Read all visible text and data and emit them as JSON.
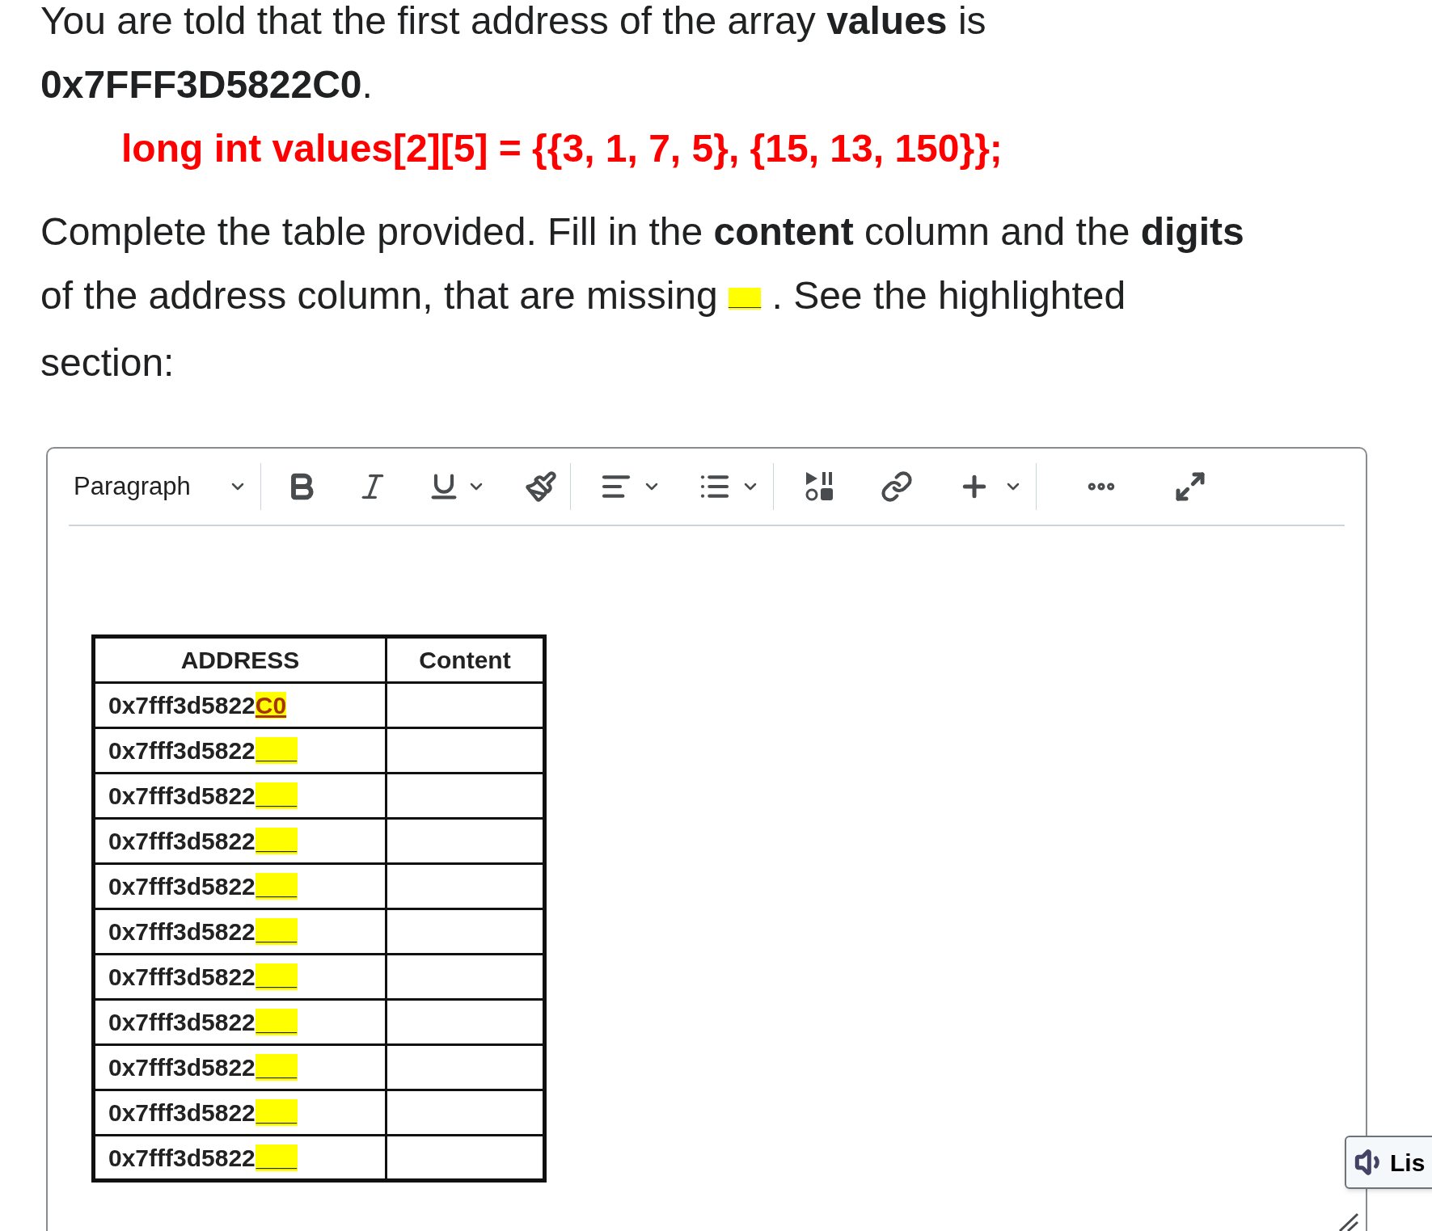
{
  "question": {
    "intro": "You are told that the first address of the array **values** is **0x7FFF3D5822C0**.",
    "code": "long int values[2][5] = {{3, 1, 7, 5}, {15, 13, 150}};",
    "instruction_before": "Complete the table provided. Fill in the **content** column and the **digits** of the address column, that are missing",
    "instruction_blank": "___",
    "instruction_after": ". See the highlighted section:"
  },
  "editor": {
    "toolbar": {
      "block_format": "Paragraph"
    },
    "table": {
      "columns": [
        "ADDRESS",
        "Content"
      ],
      "rows": [
        {
          "address_prefix": "0x7fff3d5822",
          "address_suffix": "C0",
          "kind": "given"
        },
        {
          "address_prefix": "0x7fff3d5822",
          "address_suffix": "___",
          "kind": "blank"
        },
        {
          "address_prefix": "0x7fff3d5822",
          "address_suffix": "___",
          "kind": "blank"
        },
        {
          "address_prefix": "0x7fff3d5822",
          "address_suffix": "___",
          "kind": "blank"
        },
        {
          "address_prefix": "0x7fff3d5822",
          "address_suffix": "___",
          "kind": "blank"
        },
        {
          "address_prefix": "0x7fff3d5822",
          "address_suffix": "___",
          "kind": "blank"
        },
        {
          "address_prefix": "0x7fff3d5822",
          "address_suffix": "___",
          "kind": "blank"
        },
        {
          "address_prefix": "0x7fff3d5822",
          "address_suffix": "___",
          "kind": "blank"
        },
        {
          "address_prefix": "0x7fff3d5822",
          "address_suffix": "___",
          "kind": "blank"
        },
        {
          "address_prefix": "0x7fff3d5822",
          "address_suffix": "___",
          "kind": "blank"
        },
        {
          "address_prefix": "0x7fff3d5822",
          "address_suffix": "___",
          "kind": "blank"
        }
      ]
    }
  },
  "listen_button": {
    "label": "Lis"
  }
}
